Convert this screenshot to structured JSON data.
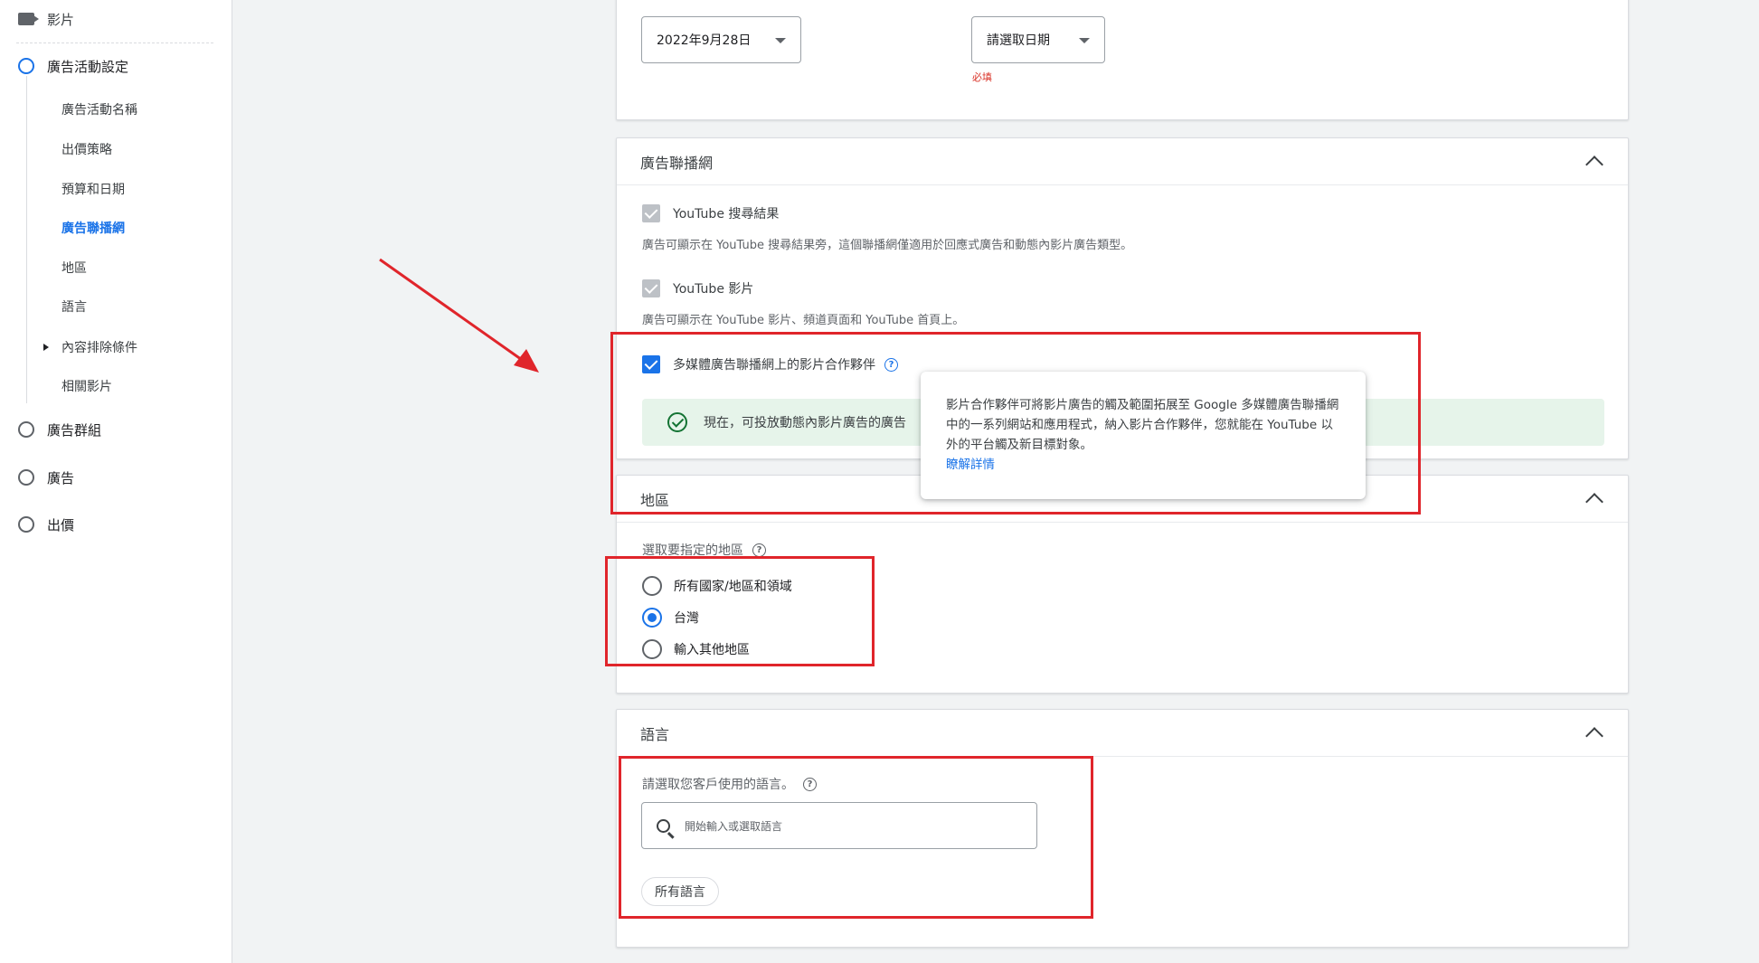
{
  "sidebar": {
    "top_item": {
      "label": "影片",
      "icon": "video-camera-icon"
    },
    "sections": [
      {
        "label": "廣告活動設定",
        "active": true
      },
      {
        "label": "廣告群組"
      },
      {
        "label": "廣告"
      },
      {
        "label": "出價"
      }
    ],
    "sub_items": [
      {
        "label": "廣告活動名稱"
      },
      {
        "label": "出價策略"
      },
      {
        "label": "預算和日期"
      },
      {
        "label": "廣告聯播網",
        "active": true
      },
      {
        "label": "地區"
      },
      {
        "label": "語言"
      },
      {
        "label": "內容排除條件",
        "expandable": true
      },
      {
        "label": "相關影片"
      }
    ]
  },
  "dates": {
    "start_value": "2022年9月28日",
    "end_value": "請選取日期",
    "end_required": "必填"
  },
  "networks": {
    "title": "廣告聯播網",
    "youtube_search": {
      "label": "YouTube 搜尋結果",
      "desc": "廣告可顯示在 YouTube 搜尋結果旁，這個聯播網僅適用於回應式廣告和動態內影片廣告類型。"
    },
    "youtube_videos": {
      "label": "YouTube 影片",
      "desc": "廣告可顯示在 YouTube 影片、頻道頁面和 YouTube 首頁上。"
    },
    "video_partners": {
      "label": "多媒體廣告聯播網上的影片合作夥伴"
    },
    "success_text": "現在，可投放動態內影片廣告的廣告",
    "tooltip": {
      "text": "影片合作夥伴可將影片廣告的觸及範圍拓展至 Google 多媒體廣告聯播網中的一系列網站和應用程式，納入影片合作夥伴，您就能在 YouTube 以外的平台觸及新目標對象。",
      "link": "瞭解詳情"
    }
  },
  "locations": {
    "title": "地區",
    "prompt": "選取要指定的地區",
    "options": [
      {
        "label": "所有國家/地區和領域",
        "selected": false
      },
      {
        "label": "台灣",
        "selected": true
      },
      {
        "label": "輸入其他地區",
        "selected": false
      }
    ]
  },
  "languages": {
    "title": "語言",
    "prompt": "請選取您客戶使用的語言。",
    "search_placeholder": "開始輸入或選取語言",
    "chip": "所有語言"
  },
  "colors": {
    "accent": "#1a73e8",
    "annotation_red": "#e0252b",
    "success_bg": "#e6f4ea"
  }
}
